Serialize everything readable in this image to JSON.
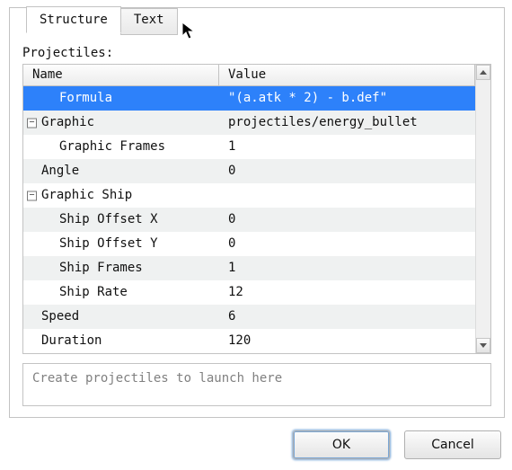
{
  "tabs": {
    "structure": "Structure",
    "text": "Text"
  },
  "section_label": "Projectiles:",
  "columns": {
    "name": "Name",
    "value": "Value"
  },
  "rows": [
    {
      "indent": 1,
      "toggle": null,
      "name": "Formula",
      "value": "\"(a.atk * 2) - b.def\"",
      "sel": true,
      "alt": false
    },
    {
      "indent": 0,
      "toggle": "−",
      "name": "Graphic",
      "value": "projectiles/energy_bullet",
      "sel": false,
      "alt": true
    },
    {
      "indent": 1,
      "toggle": null,
      "name": "Graphic Frames",
      "value": "1",
      "sel": false,
      "alt": false
    },
    {
      "indent": 0,
      "toggle": null,
      "name": "Angle",
      "value": "0",
      "sel": false,
      "alt": true
    },
    {
      "indent": 0,
      "toggle": "−",
      "name": "Graphic Ship",
      "value": "",
      "sel": false,
      "alt": false
    },
    {
      "indent": 1,
      "toggle": null,
      "name": "Ship Offset X",
      "value": "0",
      "sel": false,
      "alt": true
    },
    {
      "indent": 1,
      "toggle": null,
      "name": "Ship Offset Y",
      "value": "0",
      "sel": false,
      "alt": false
    },
    {
      "indent": 1,
      "toggle": null,
      "name": "Ship Frames",
      "value": "1",
      "sel": false,
      "alt": true
    },
    {
      "indent": 1,
      "toggle": null,
      "name": "Ship Rate",
      "value": "12",
      "sel": false,
      "alt": false
    },
    {
      "indent": 0,
      "toggle": null,
      "name": "Speed",
      "value": "6",
      "sel": false,
      "alt": true
    },
    {
      "indent": 0,
      "toggle": null,
      "name": "Duration",
      "value": "120",
      "sel": false,
      "alt": false
    }
  ],
  "hint": "Create projectiles to launch here",
  "buttons": {
    "ok": "OK",
    "cancel": "Cancel"
  }
}
